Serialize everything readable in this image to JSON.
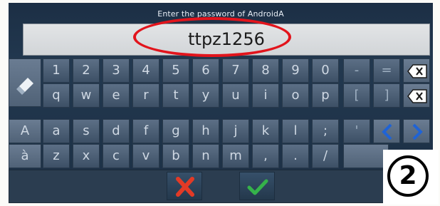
{
  "dialog": {
    "prompt": "Enter the password of AndroidA",
    "password_value": "ttpz1256"
  },
  "keyboard": {
    "row1": [
      "1",
      "2",
      "3",
      "4",
      "5",
      "6",
      "7",
      "8",
      "9",
      "0",
      "-",
      "="
    ],
    "row2": [
      "q",
      "w",
      "e",
      "r",
      "t",
      "y",
      "u",
      "i",
      "o",
      "p",
      "[",
      "]"
    ],
    "row3_shift": "A",
    "row3": [
      "a",
      "s",
      "d",
      "f",
      "g",
      "h",
      "j",
      "k",
      "l",
      ";",
      "'"
    ],
    "row4_accent": "à",
    "row4": [
      "z",
      "x",
      "c",
      "v",
      "b",
      "n",
      "m",
      ",",
      ".",
      "/"
    ]
  },
  "annotation": {
    "step_number": "2",
    "highlight_color": "#e2141c"
  },
  "colors": {
    "cancel": "#e23a26",
    "confirm": "#35b24a",
    "arrow": "#1f63d6"
  }
}
